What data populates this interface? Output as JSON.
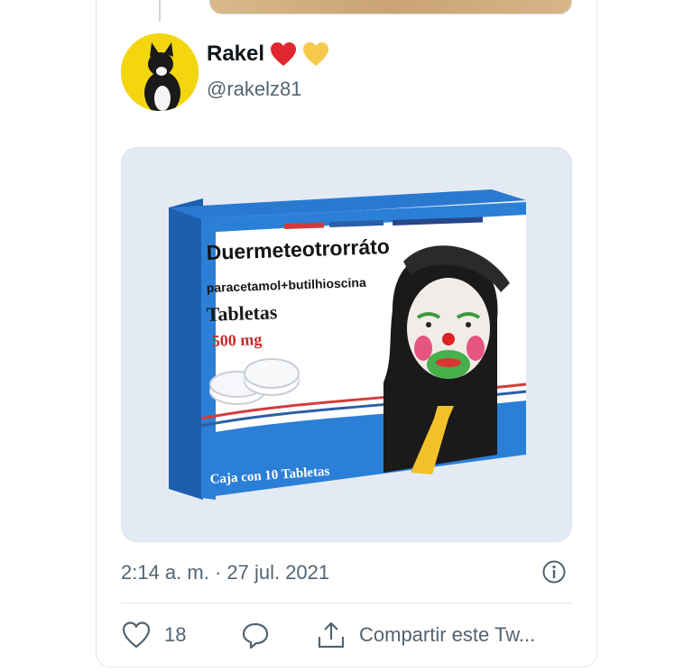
{
  "user": {
    "display_name": "Rakel",
    "emojis": [
      "red-heart-emoji",
      "yellow-heart-emoji"
    ],
    "handle": "@rakelz81"
  },
  "media": {
    "product_name": "Duermeteotrorráto",
    "ingredients": "paracetamol+butilhioscina",
    "form": "Tabletas",
    "dose": "500 mg",
    "box_note": "Caja con 10 Tabletas"
  },
  "timestamp": "2:14 a. m. · 27 jul. 2021",
  "actions": {
    "like_count": "18",
    "share_label": "Compartir este Tw..."
  },
  "colors": {
    "text_primary": "#0f1419",
    "text_secondary": "#536471",
    "box_blue": "#1f6fc4",
    "dose_red": "#cc2a2a"
  }
}
